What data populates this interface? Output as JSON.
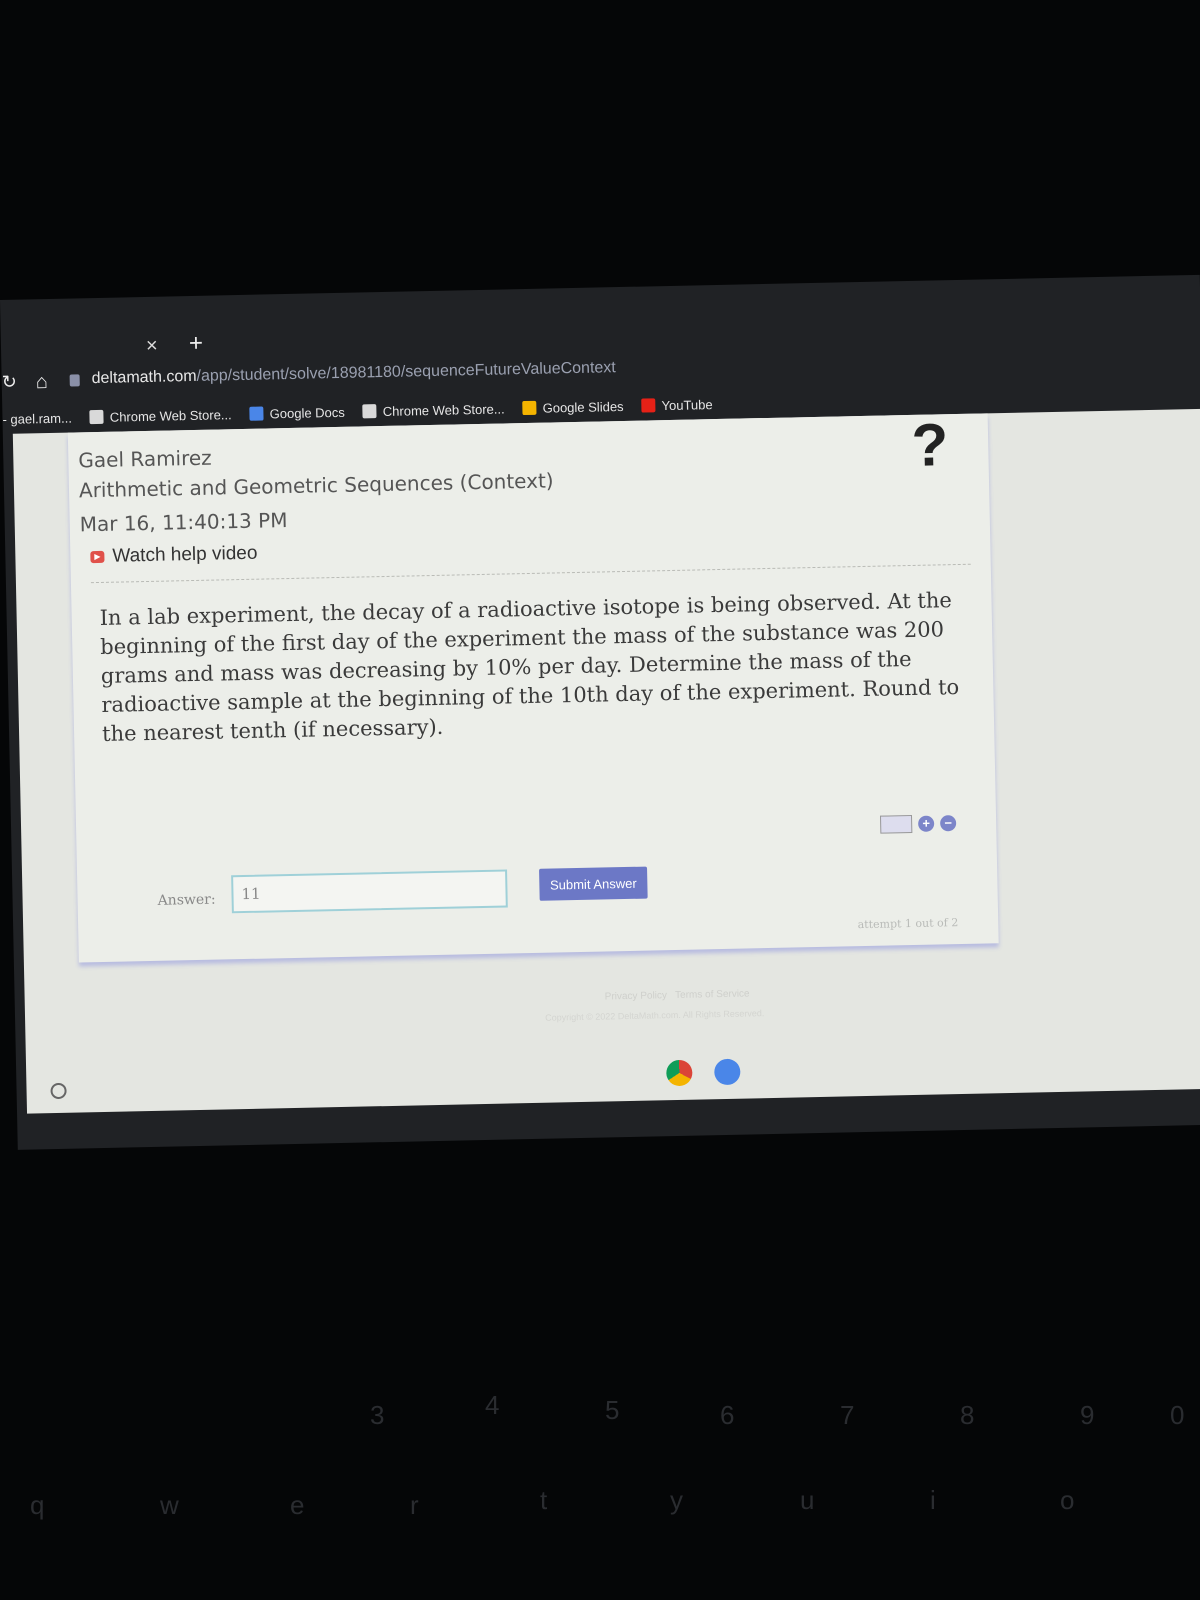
{
  "browser": {
    "tab_close": "×",
    "tab_new": "+",
    "url_host": "deltamath.com",
    "url_path": "/app/student/solve/18981180/sequenceFutureValueContext",
    "profile_tab": "- gael.ram...",
    "bookmarks": [
      {
        "label": "Chrome Web Store...",
        "icon": "chrome-web-store-icon",
        "color": "#d9d9d9"
      },
      {
        "label": "Google Docs",
        "icon": "google-docs-icon",
        "color": "#4a86e8"
      },
      {
        "label": "Chrome Web Store...",
        "icon": "chrome-web-store-icon",
        "color": "#d9d9d9"
      },
      {
        "label": "Google Slides",
        "icon": "google-slides-icon",
        "color": "#f4b400"
      },
      {
        "label": "YouTube",
        "icon": "youtube-icon",
        "color": "#e62117"
      }
    ]
  },
  "header": {
    "student": "Gael Ramirez",
    "assignment": "Arithmetic and Geometric Sequences (Context)",
    "datetime": "Mar 16, 11:40:13 PM",
    "help_video": "Watch help video",
    "help_icon": "?"
  },
  "problem": {
    "text": "In a lab experiment, the decay of a radioactive isotope is being observed. At the beginning of the first day of the experiment the mass of the substance was 200 grams and mass was decreasing by 10% per day. Determine the mass of the radioactive sample at the beginning of the 10th day of the experiment. Round to the nearest tenth (if necessary)."
  },
  "answer": {
    "label": "Answer:",
    "value": "11",
    "submit": "Submit Answer",
    "attempt": "attempt 1 out of 2"
  },
  "tools": {
    "zoom_in": "+",
    "zoom_out": "−"
  },
  "footer": {
    "privacy": "Privacy Policy",
    "terms": "Terms of Service",
    "copyright": "Copyright © 2022 DeltaMath.com. All Rights Reserved."
  },
  "keyboard": [
    "3",
    "4",
    "5",
    "6",
    "7",
    "8",
    "9",
    "0",
    "q",
    "w",
    "e",
    "r",
    "t",
    "y",
    "u",
    "i",
    "o"
  ],
  "colors": {
    "accent": "#6c78c6",
    "input_border": "#9fd0d8"
  }
}
